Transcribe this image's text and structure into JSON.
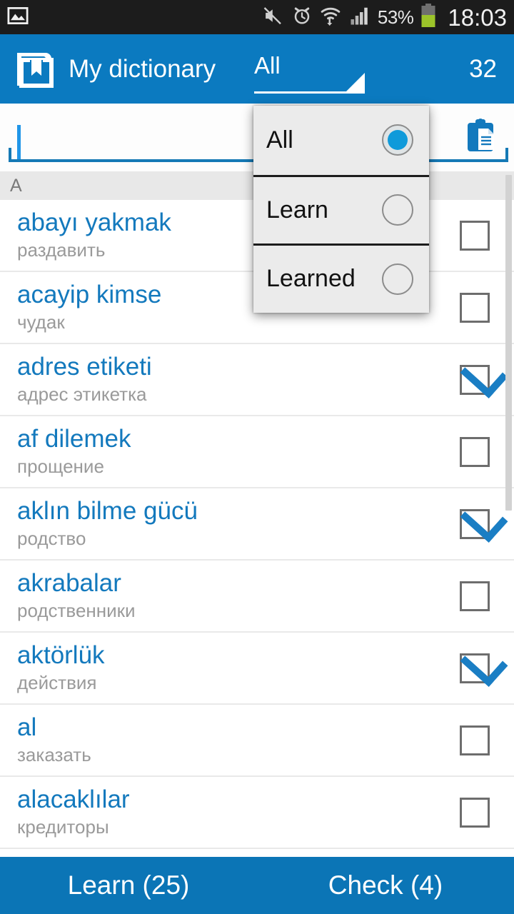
{
  "status_bar": {
    "icons": [
      "image-icon",
      "mute-icon",
      "alarm-icon",
      "wifi-transfer-icon",
      "signal-icon"
    ],
    "battery_percent": "53%",
    "clock": "18:03"
  },
  "action_bar": {
    "logo": "book-bookmark-icon",
    "title": "My dictionary",
    "filter_label": "All",
    "caret": "dropdown-caret-icon",
    "count": "32"
  },
  "search": {
    "value": "",
    "placeholder": "",
    "clipboard_icon": "clipboard-icon"
  },
  "section": {
    "letter": "A"
  },
  "list": {
    "rows": [
      {
        "term": "abayı yakmak",
        "translation": "раздавить",
        "checked": false
      },
      {
        "term": "acayip kimse",
        "translation": "чудак",
        "checked": false
      },
      {
        "term": "adres etiketi",
        "translation": "адрес этикетка",
        "checked": true
      },
      {
        "term": "af dilemek",
        "translation": "прощение",
        "checked": false
      },
      {
        "term": "aklın bilme gücü",
        "translation": "родство",
        "checked": true
      },
      {
        "term": "akrabalar",
        "translation": "родственники",
        "checked": false
      },
      {
        "term": "aktörlük",
        "translation": "действия",
        "checked": true
      },
      {
        "term": "al",
        "translation": "заказать",
        "checked": false
      },
      {
        "term": "alacaklılar",
        "translation": "кредиторы",
        "checked": false
      }
    ]
  },
  "dropdown": {
    "options": [
      {
        "label": "All",
        "selected": true
      },
      {
        "label": "Learn",
        "selected": false
      },
      {
        "label": "Learned",
        "selected": false
      }
    ]
  },
  "bottom_bar": {
    "learn_label": "Learn (25)",
    "check_label": "Check (4)"
  },
  "colors": {
    "accent_blue": "#0b7ac0",
    "bottom_blue": "#0b75b6",
    "term_blue": "#1379bd",
    "translation_gray": "#9a9a9a",
    "status_bar_bg": "#1c1c1c",
    "radio_blue": "#0f9ada"
  }
}
